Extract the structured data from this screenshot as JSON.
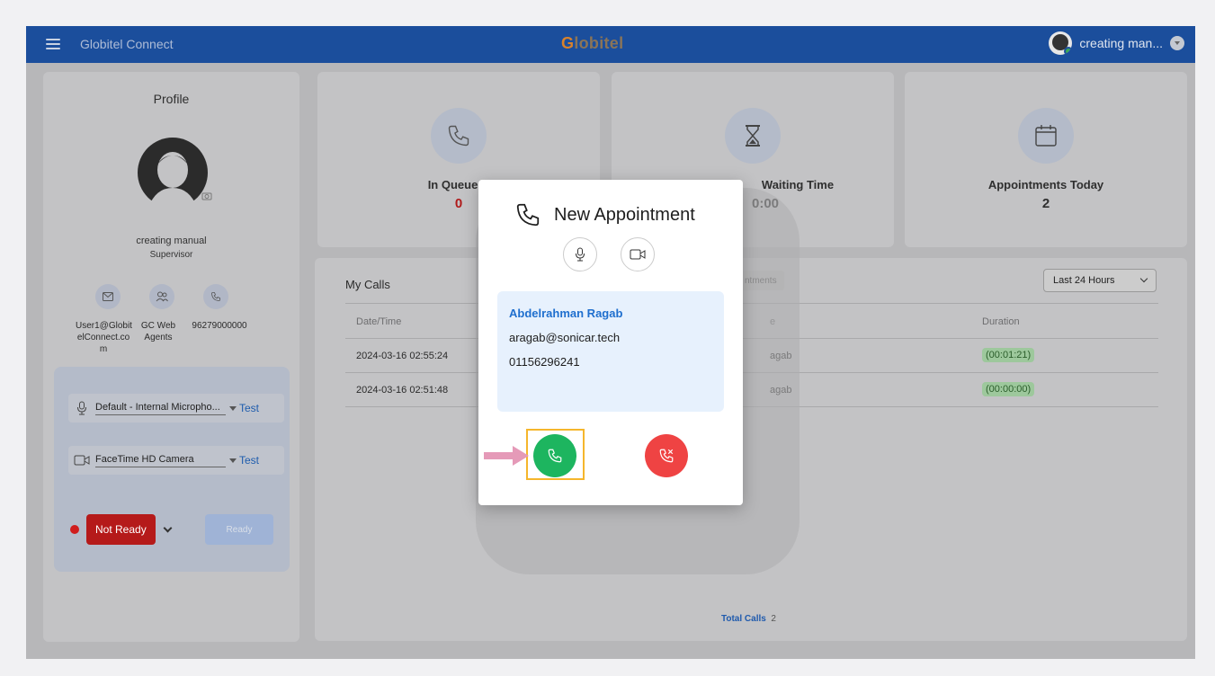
{
  "topbar": {
    "app_title": "Globitel Connect",
    "logo_initial": "G",
    "logo_rest": "lobitel",
    "user_name": "creating man..."
  },
  "profile": {
    "title": "Profile",
    "name": "creating manual",
    "role": "Supervisor",
    "contacts": [
      {
        "icon": "mail-icon",
        "text": "User1@Globit elConnect.co m"
      },
      {
        "icon": "group-icon",
        "text": "GC Web Agents"
      },
      {
        "icon": "phone-icon",
        "text": "96279000000"
      }
    ],
    "microphone": "Default - Internal Micropho...",
    "camera": "FaceTime HD Camera",
    "test_label": "Test",
    "status_button": "Not Ready",
    "ready_button": "Ready"
  },
  "stats": [
    {
      "label": "In Queue N",
      "value": "0",
      "icon": "phone-icon"
    },
    {
      "label": "Waiting Time",
      "value": "0:00",
      "icon": "hourglass-icon"
    },
    {
      "label": "Appointments Today",
      "value": "2",
      "icon": "calendar-icon"
    }
  ],
  "calls": {
    "title": "My Calls",
    "tab_label": "ntments",
    "range": "Last 24 Hours",
    "columns": [
      "Date/Time",
      "e",
      "Duration"
    ],
    "rows": [
      {
        "datetime": "2024-03-16 02:55:24",
        "name": "agab",
        "duration": "(00:01:21)"
      },
      {
        "datetime": "2024-03-16 02:51:48",
        "name": "agab",
        "duration": "(00:00:00)"
      }
    ],
    "total_label": "Total Calls",
    "total_value": "2"
  },
  "modal": {
    "title": "New Appointment",
    "caller_name": "Abdelrahman Ragab",
    "caller_email": "aragab@sonicar.tech",
    "caller_phone": "01156296241"
  },
  "colors": {
    "topbar": "#1b4e9c",
    "accept": "#1db55f",
    "reject": "#ef4343",
    "highlight": "#f5b62c",
    "arrow": "#e59ab8"
  }
}
